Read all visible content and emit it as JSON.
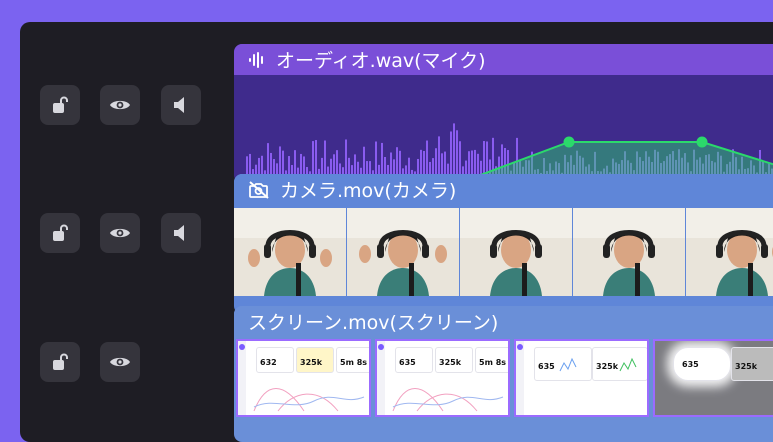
{
  "controls": {
    "rows": [
      {
        "lock": "unlock-icon",
        "visibility": "eye-icon",
        "sound": "speaker-icon"
      },
      {
        "lock": "unlock-icon",
        "visibility": "eye-icon",
        "sound": "speaker-icon"
      },
      {
        "lock": "unlock-icon",
        "visibility": "eye-icon"
      }
    ]
  },
  "tracks": {
    "audio": {
      "icon": "waveform-icon",
      "title": "オーディオ.wav(マイク)"
    },
    "camera": {
      "icon": "camera-off-icon",
      "title": "カメラ.mov(カメラ)"
    },
    "screen": {
      "title": "スクリーン.mov(スクリーン)"
    }
  },
  "screen_thumbs": [
    {
      "n1": "632",
      "n2": "325k",
      "n3": "5m 8s"
    },
    {
      "n1": "635",
      "n2": "325k",
      "n3": "5m 8s"
    },
    {
      "n1": "635",
      "n2": "325k"
    },
    {
      "n1": "635",
      "n2": "325k"
    }
  ],
  "colors": {
    "background": "#7b63f0",
    "panel": "#1e1d24",
    "audio_header": "#7a4fd8",
    "audio_body": "#3f2b8c",
    "waveform": "#8a5cf0",
    "envelope": "#2bd96b",
    "camera_header": "#5f86d8",
    "screen_header": "#6a8fd8"
  }
}
